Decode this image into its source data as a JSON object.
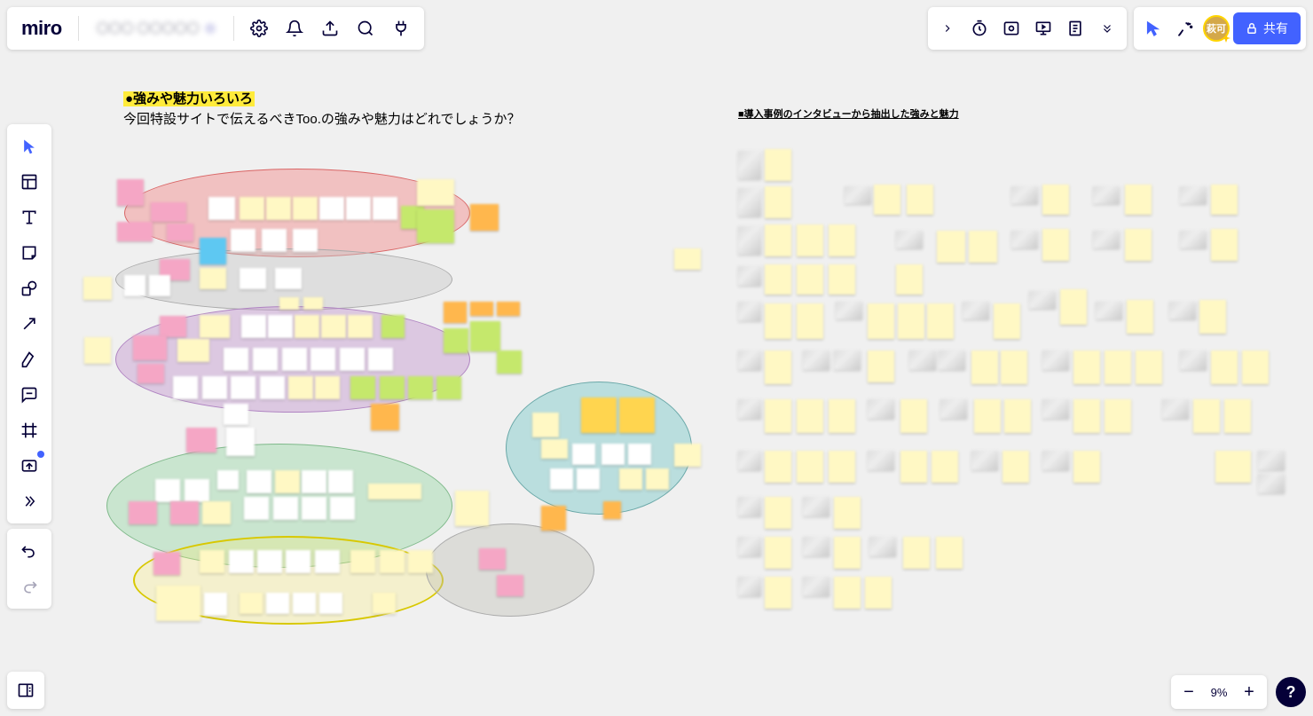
{
  "header": {
    "logo_text": "miro",
    "board_name": "〇〇〇 〇〇〇〇〇",
    "share_label": "共有",
    "avatar_label": "萩可"
  },
  "canvas": {
    "heading_highlight": "●強みや魅力いろいろ",
    "heading_sub": "今回特設サイトで伝えるべきToo.の強みや魅力はどれでしょうか？",
    "section2_title": "■導入事例のインタビューから抽出した強みと魅力"
  },
  "zoom": {
    "level": "9%"
  },
  "tooltips": {
    "select": "選択",
    "templates": "テンプレート",
    "text": "テキスト",
    "sticky": "付箋",
    "shape": "図形",
    "line": "接続線",
    "pen": "ペン",
    "comment": "コメント",
    "frame": "フレーム",
    "upload": "アップロード",
    "more": "その他",
    "undo": "元に戻す",
    "redo": "やり直し",
    "settings": "設定",
    "notifications": "通知",
    "export": "エクスポート",
    "search": "検索",
    "apps": "アプリ",
    "timer": "タイマー",
    "present": "プレゼンテーション",
    "notes": "ノート",
    "cursor": "カーソル",
    "reactions": "リアクション",
    "frames_panel": "フレーム",
    "zoom_out": "縮小",
    "zoom_in": "拡大",
    "help": "ヘルプ"
  }
}
